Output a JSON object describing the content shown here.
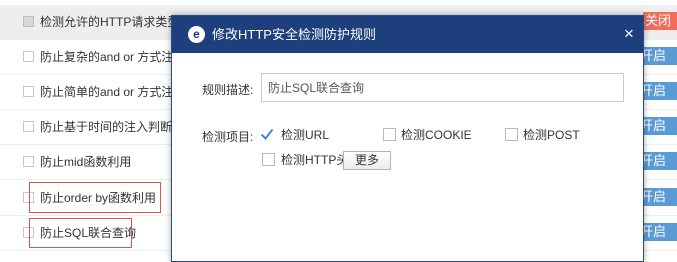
{
  "rules": [
    {
      "label": "检测允许的HTTP请求类型",
      "status": "已关闭"
    },
    {
      "label": "防止复杂的and or 方式注入",
      "status": "开启"
    },
    {
      "label": "防止简单的and or 方式注入",
      "status": "开启"
    },
    {
      "label": "防止基于时间的注入判断",
      "status": "开启"
    },
    {
      "label": "防止mid函数利用",
      "status": "开启"
    },
    {
      "label": "防止order by函数利用",
      "status": "开启"
    },
    {
      "label": "防止SQL联合查询",
      "status": "开启"
    }
  ],
  "colors": {
    "header": "#1e3f7d",
    "status_on": "#5b9bd5",
    "status_off": "#f26b5b",
    "highlight_border": "#d9534f"
  },
  "modal": {
    "logo": "e",
    "title": "修改HTTP安全检测防护规则",
    "close": "×",
    "description_label": "规则描述:",
    "description_value": "防止SQL联合查询",
    "items_label": "检测项目:",
    "options": [
      {
        "label": "检测URL",
        "checked": true
      },
      {
        "label": "检测COOKIE",
        "checked": false
      },
      {
        "label": "检测POST",
        "checked": false
      },
      {
        "label": "检测HTTP头",
        "checked": false
      }
    ],
    "more_button": "更多"
  }
}
